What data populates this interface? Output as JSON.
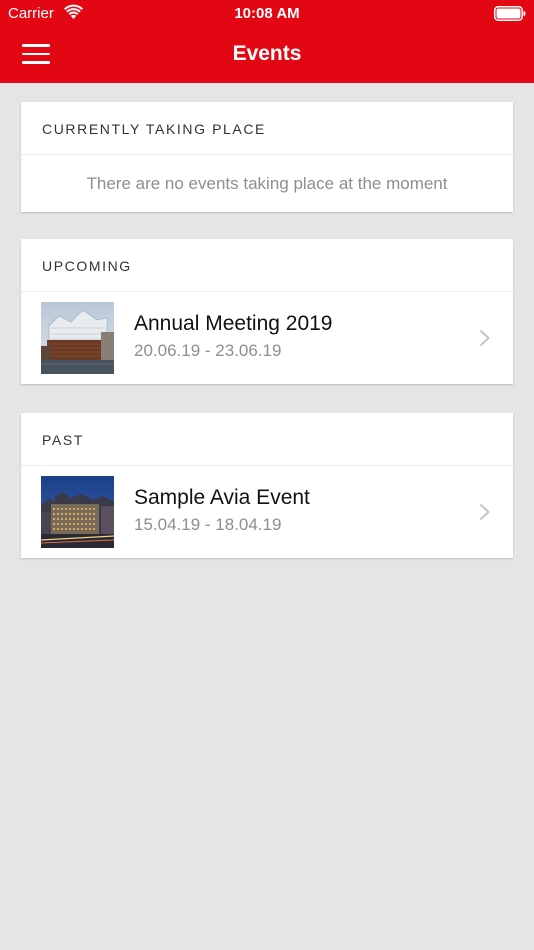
{
  "status_bar": {
    "carrier": "Carrier",
    "time": "10:08 AM",
    "wifi_icon": "wifi-icon",
    "battery_icon": "battery-icon"
  },
  "nav": {
    "title": "Events",
    "menu_icon": "hamburger-menu-icon"
  },
  "colors": {
    "brand": "#e30613",
    "background": "#e5e5e5",
    "card": "#ffffff",
    "secondary_text": "#8e8e8e"
  },
  "sections": {
    "current": {
      "header": "CURRENTLY TAKING PLACE",
      "empty_message": "There are no events taking place at the moment"
    },
    "upcoming": {
      "header": "UPCOMING",
      "events": [
        {
          "title": "Annual Meeting 2019",
          "dates": "20.06.19 - 23.06.19",
          "thumbnail": "concert-hall-building-photo"
        }
      ]
    },
    "past": {
      "header": "PAST",
      "events": [
        {
          "title": "Sample Avia Event",
          "dates": "15.04.19 - 18.04.19",
          "thumbnail": "city-street-night-photo"
        }
      ]
    }
  }
}
